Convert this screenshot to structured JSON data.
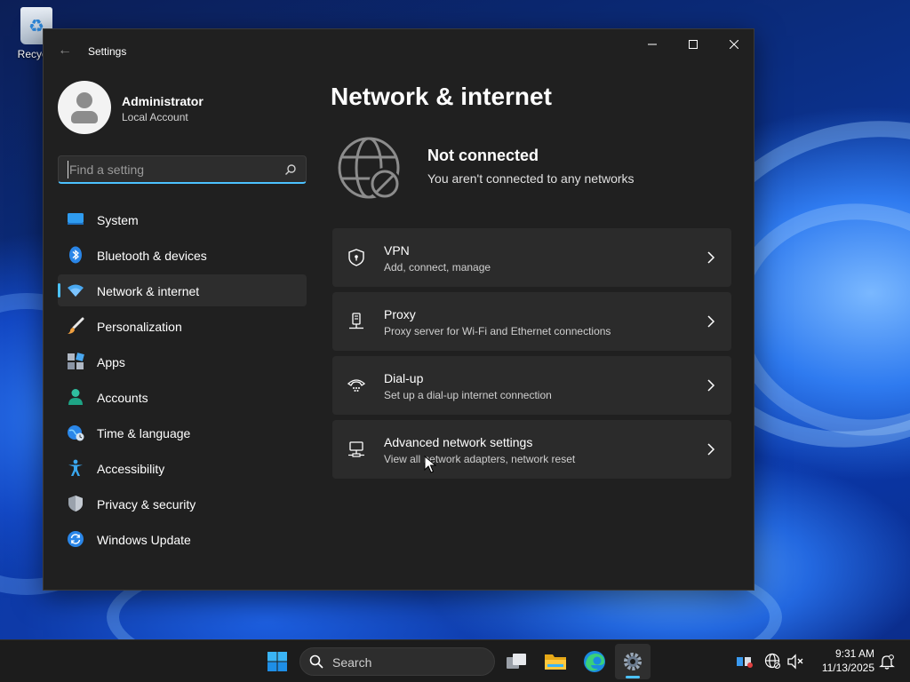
{
  "desktop": {
    "recycle_bin_label": "Recycle"
  },
  "window": {
    "app_title": "Settings",
    "controls": [
      "minimize",
      "maximize",
      "close"
    ]
  },
  "profile": {
    "name": "Administrator",
    "account_type": "Local Account"
  },
  "search": {
    "placeholder": "Find a setting",
    "value": ""
  },
  "nav": {
    "items": [
      {
        "label": "System",
        "icon": "monitor-icon"
      },
      {
        "label": "Bluetooth & devices",
        "icon": "bluetooth-icon"
      },
      {
        "label": "Network & internet",
        "icon": "wifi-icon",
        "selected": true
      },
      {
        "label": "Personalization",
        "icon": "brush-icon"
      },
      {
        "label": "Apps",
        "icon": "apps-icon"
      },
      {
        "label": "Accounts",
        "icon": "person-icon"
      },
      {
        "label": "Time & language",
        "icon": "globe-clock-icon"
      },
      {
        "label": "Accessibility",
        "icon": "accessibility-icon"
      },
      {
        "label": "Privacy & security",
        "icon": "shield-icon"
      },
      {
        "label": "Windows Update",
        "icon": "update-icon"
      }
    ]
  },
  "main": {
    "page_title": "Network & internet",
    "status": {
      "title": "Not connected",
      "subtitle": "You aren't connected to any networks",
      "icon": "globe-blocked-icon"
    },
    "cards": [
      {
        "title": "VPN",
        "subtitle": "Add, connect, manage",
        "icon": "vpn-shield-icon"
      },
      {
        "title": "Proxy",
        "subtitle": "Proxy server for Wi-Fi and Ethernet connections",
        "icon": "proxy-icon"
      },
      {
        "title": "Dial-up",
        "subtitle": "Set up a dial-up internet connection",
        "icon": "dialup-icon"
      },
      {
        "title": "Advanced network settings",
        "subtitle": "View all network adapters, network reset",
        "icon": "computer-network-icon"
      }
    ]
  },
  "taskbar": {
    "search_label": "Search",
    "apps": [
      "start-icon",
      "task-view-icon",
      "file-explorer-icon",
      "edge-icon",
      "settings-icon"
    ],
    "active_app": "settings-icon",
    "tray": [
      "network-adapter-icon",
      "globe-network-icon",
      "speaker-muted-icon"
    ],
    "time": "9:31 AM",
    "date": "11/13/2025"
  },
  "colors": {
    "accent": "#4cc2ff",
    "window_bg": "#202020",
    "card_bg": "#2b2b2b",
    "taskbar_bg": "#1c1c1c"
  }
}
